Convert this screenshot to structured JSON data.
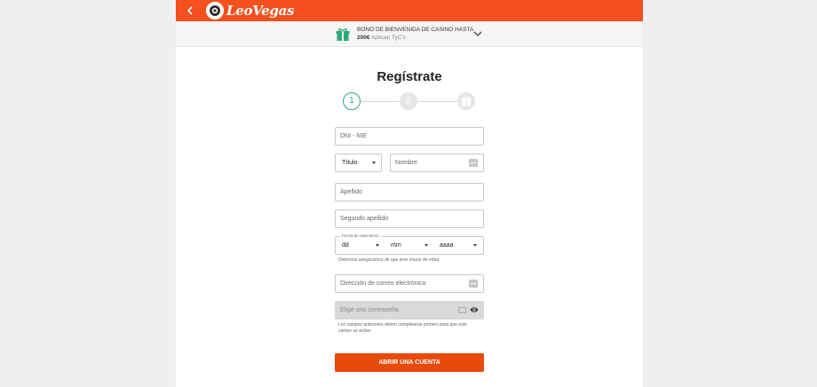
{
  "header": {
    "brand": "LeoVegas",
    "brand_color": "#f4511e",
    "back_icon": "chevron-left-icon"
  },
  "promo": {
    "line1": "BONO DE BIENVENIDA DE CASINO HASTA",
    "amount": "200€",
    "terms": "Aplican TyC's",
    "icon": "gift-icon",
    "gift_color": "#2bab74"
  },
  "form": {
    "title": "Regístrate",
    "steps": [
      {
        "label": "1",
        "state": "active"
      },
      {
        "label": "2",
        "state": "inactive"
      },
      {
        "label": "",
        "icon": "gift-icon",
        "state": "inactive"
      }
    ],
    "dni_placeholder": "DNI - NIE",
    "title_select_value": "Título",
    "name_placeholder": "Nombre",
    "surname_placeholder": "Apellido",
    "second_surname_placeholder": "Segundo apellido",
    "dob": {
      "legend": "Fecha de nacimiento",
      "day": "dd",
      "month": "mm",
      "year": "aaaa",
      "help": "Debemos asegurarnos de que eres mayor de edad."
    },
    "email_placeholder": "Dirección de correo electrónico",
    "password_placeholder": "Elige una contraseña",
    "password_help_line1": "Los campos anteriores deben completarse primero para que este",
    "password_help_line2": "campo se active.",
    "submit_label": "ABRIR UNA CUENTA",
    "submit_color": "#e84a0c"
  }
}
